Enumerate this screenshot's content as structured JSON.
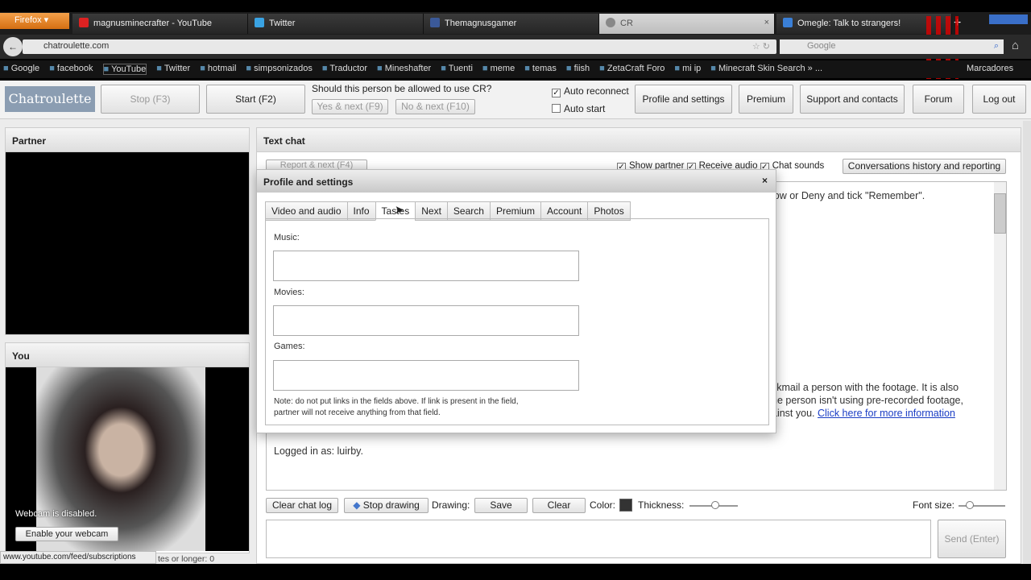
{
  "browser": {
    "menu_label": "Firefox",
    "tabs": [
      {
        "label": "magnusminecrafter - YouTube",
        "icon": "youtube-icon",
        "color": "#d22"
      },
      {
        "label": "Twitter",
        "icon": "twitter-icon",
        "color": "#3aa3e3"
      },
      {
        "label": "Themagnusgamer",
        "icon": "facebook-icon",
        "color": "#3b5998"
      },
      {
        "label": "CR",
        "icon": "chatroulette-icon",
        "color": "#888"
      },
      {
        "label": "Omegle: Talk to strangers!",
        "icon": "omegle-icon",
        "color": "#3a7fd6"
      }
    ],
    "new_tab": "+",
    "url": "chatroulette.com",
    "search_placeholder": "Google",
    "bookmarks": [
      "Google",
      "facebook",
      "YouTube",
      "Twitter",
      "hotmail",
      "simpsonizados",
      "Traductor",
      "Mineshafter",
      "Tuenti",
      "meme",
      "temas",
      "fiish",
      "ZetaCraft Foro",
      "mi ip",
      "Minecraft Skin Search » ..."
    ],
    "bookmarks_menu": "Marcadores",
    "status_url": "www.youtube.com/feed/subscriptions"
  },
  "toolbar": {
    "logo": "Chatroulette",
    "stop": "Stop (F3)",
    "start": "Start (F2)",
    "question": "Should this person be allowed to use CR?",
    "yes_next": "Yes & next (F9)",
    "no_next": "No & next (F10)",
    "auto_reconnect": "Auto reconnect",
    "auto_start": "Auto start",
    "profile": "Profile and settings",
    "premium": "Premium",
    "support": "Support and contacts",
    "forum": "Forum",
    "logout": "Log out"
  },
  "partner": {
    "title": "Partner"
  },
  "you": {
    "title": "You",
    "webcam_disabled": "Webcam is disabled.",
    "enable_webcam": "Enable your webcam",
    "footer_text": "tes or longer: 0"
  },
  "chat": {
    "title": "Text chat",
    "report_next": "Report & next (F4)",
    "show_partner": "Show partner",
    "receive_audio": "Receive audio",
    "chat_sounds": "Chat sounds",
    "history": "Conversations history and reporting",
    "line1": "low or Deny and tick \"Remember\".",
    "para": [
      "ckmail a person with the footage. It is also",
      "he person isn't using pre-recorded footage,",
      "ainst you."
    ],
    "link": "Click here for more information",
    "logged_in": "Logged in as: luirby.",
    "clear_log": "Clear chat log",
    "stop_drawing": "Stop drawing",
    "drawing": "Drawing:",
    "save": "Save",
    "clear": "Clear",
    "color": "Color:",
    "thickness": "Thickness:",
    "font_size": "Font size:",
    "send": "Send (Enter)"
  },
  "dialog": {
    "title": "Profile and settings",
    "close": "×",
    "tabs": [
      "Video and audio",
      "Info",
      "Tastes",
      "Next",
      "Search",
      "Premium",
      "Account",
      "Photos"
    ],
    "music": "Music:",
    "movies": "Movies:",
    "games": "Games:",
    "note": [
      "Note: do not put links in the fields above. If link is present in the field,",
      "partner will not receive anything from that field."
    ]
  }
}
